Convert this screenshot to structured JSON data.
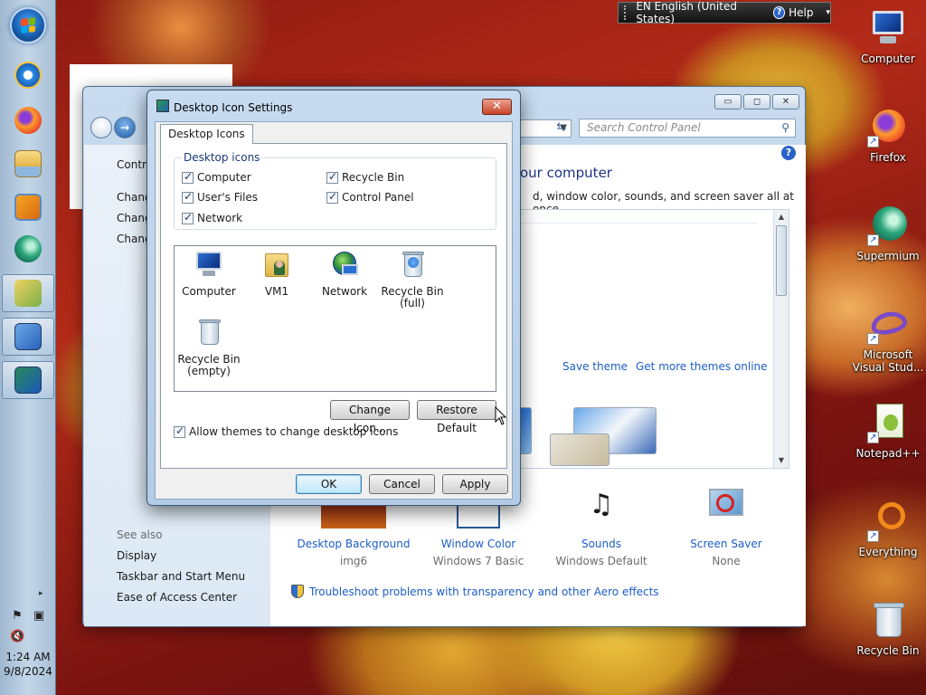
{
  "colors": {
    "link": "#1d5ec5",
    "heading": "#1e3287",
    "taskbar": "#b9cde2",
    "close_red": "#c8442a"
  },
  "taskbar": {
    "clock_time": "1:24 AM",
    "clock_date": "9/8/2024",
    "icons": [
      "start-orb-icon",
      "internet-explorer-icon",
      "firefox-icon",
      "file-explorer-icon",
      "media-player-icon",
      "supermium-icon",
      "desktop-icon-settings-icon",
      "control-panel-icon",
      "personalization-icon"
    ],
    "tray_icons": [
      "flag-icon",
      "network-icon",
      "volume-muted-icon"
    ],
    "tray_expand_glyph": "▸"
  },
  "langbar": {
    "language": "EN English (United States)",
    "help_label": "Help",
    "help_glyph": "?",
    "menu_glyph": "▾"
  },
  "desktop_icons": [
    {
      "label": "Computer",
      "icon": "computer-icon"
    },
    {
      "label": "Firefox",
      "icon": "firefox-icon"
    },
    {
      "label": "Supermium",
      "icon": "supermium-icon"
    },
    {
      "label": "Microsoft Visual Stud...",
      "icon": "visual-studio-icon"
    },
    {
      "label": "Notepad++",
      "icon": "notepad-plus-plus-icon"
    },
    {
      "label": "Everything",
      "icon": "everything-icon"
    },
    {
      "label": "Recycle Bin",
      "icon": "recycle-bin-icon"
    }
  ],
  "control_panel": {
    "search_placeholder": "Search Control Panel",
    "help_glyph": "?",
    "heading": "our computer",
    "subheading": "d, window color, sounds, and screen saver all at once.",
    "left_items": [
      "Contro",
      "Chang",
      "Chang",
      "Chang"
    ],
    "see_also_title": "See also",
    "see_also": [
      "Display",
      "Taskbar and Start Menu",
      "Ease of Access Center"
    ],
    "save_theme": "Save theme",
    "get_more_themes": "Get more themes online",
    "bottom_items": [
      {
        "label": "Desktop Background",
        "sub": "img6",
        "icon": "desktop-background-icon"
      },
      {
        "label": "Window Color",
        "sub": "Windows 7 Basic",
        "icon": "window-color-icon"
      },
      {
        "label": "Sounds",
        "sub": "Windows Default",
        "icon": "sounds-icon"
      },
      {
        "label": "Screen Saver",
        "sub": "None",
        "icon": "screen-saver-icon"
      }
    ],
    "troubleshoot": "Troubleshoot problems with transparency and other Aero effects",
    "caption_glyphs": {
      "minimize": "▭",
      "maximize": "◻",
      "close": "✕"
    }
  },
  "dialog": {
    "title": "Desktop Icon Settings",
    "close_glyph": "✕",
    "tab": "Desktop Icons",
    "group_title": "Desktop icons",
    "checkboxes": [
      {
        "label": "Computer",
        "checked": true
      },
      {
        "label": "Recycle Bin",
        "checked": true
      },
      {
        "label": "User's Files",
        "checked": true
      },
      {
        "label": "Control Panel",
        "checked": true
      },
      {
        "label": "Network",
        "checked": true
      }
    ],
    "icon_list": [
      {
        "label": "Computer",
        "icon": "computer-icon"
      },
      {
        "label": "VM1",
        "icon": "user-folder-icon"
      },
      {
        "label": "Network",
        "icon": "network-icon"
      },
      {
        "label": "Recycle Bin (full)",
        "line1": "Recycle Bin",
        "line2": "(full)",
        "icon": "recycle-bin-full-icon"
      },
      {
        "label": "Recycle Bin (empty)",
        "line1": "Recycle Bin",
        "line2": "(empty)",
        "icon": "recycle-bin-empty-icon"
      }
    ],
    "change_icon": "Change Icon...",
    "restore_default": "Restore Default",
    "allow_themes": "Allow themes to change desktop icons",
    "ok": "OK",
    "cancel": "Cancel",
    "apply": "Apply"
  }
}
